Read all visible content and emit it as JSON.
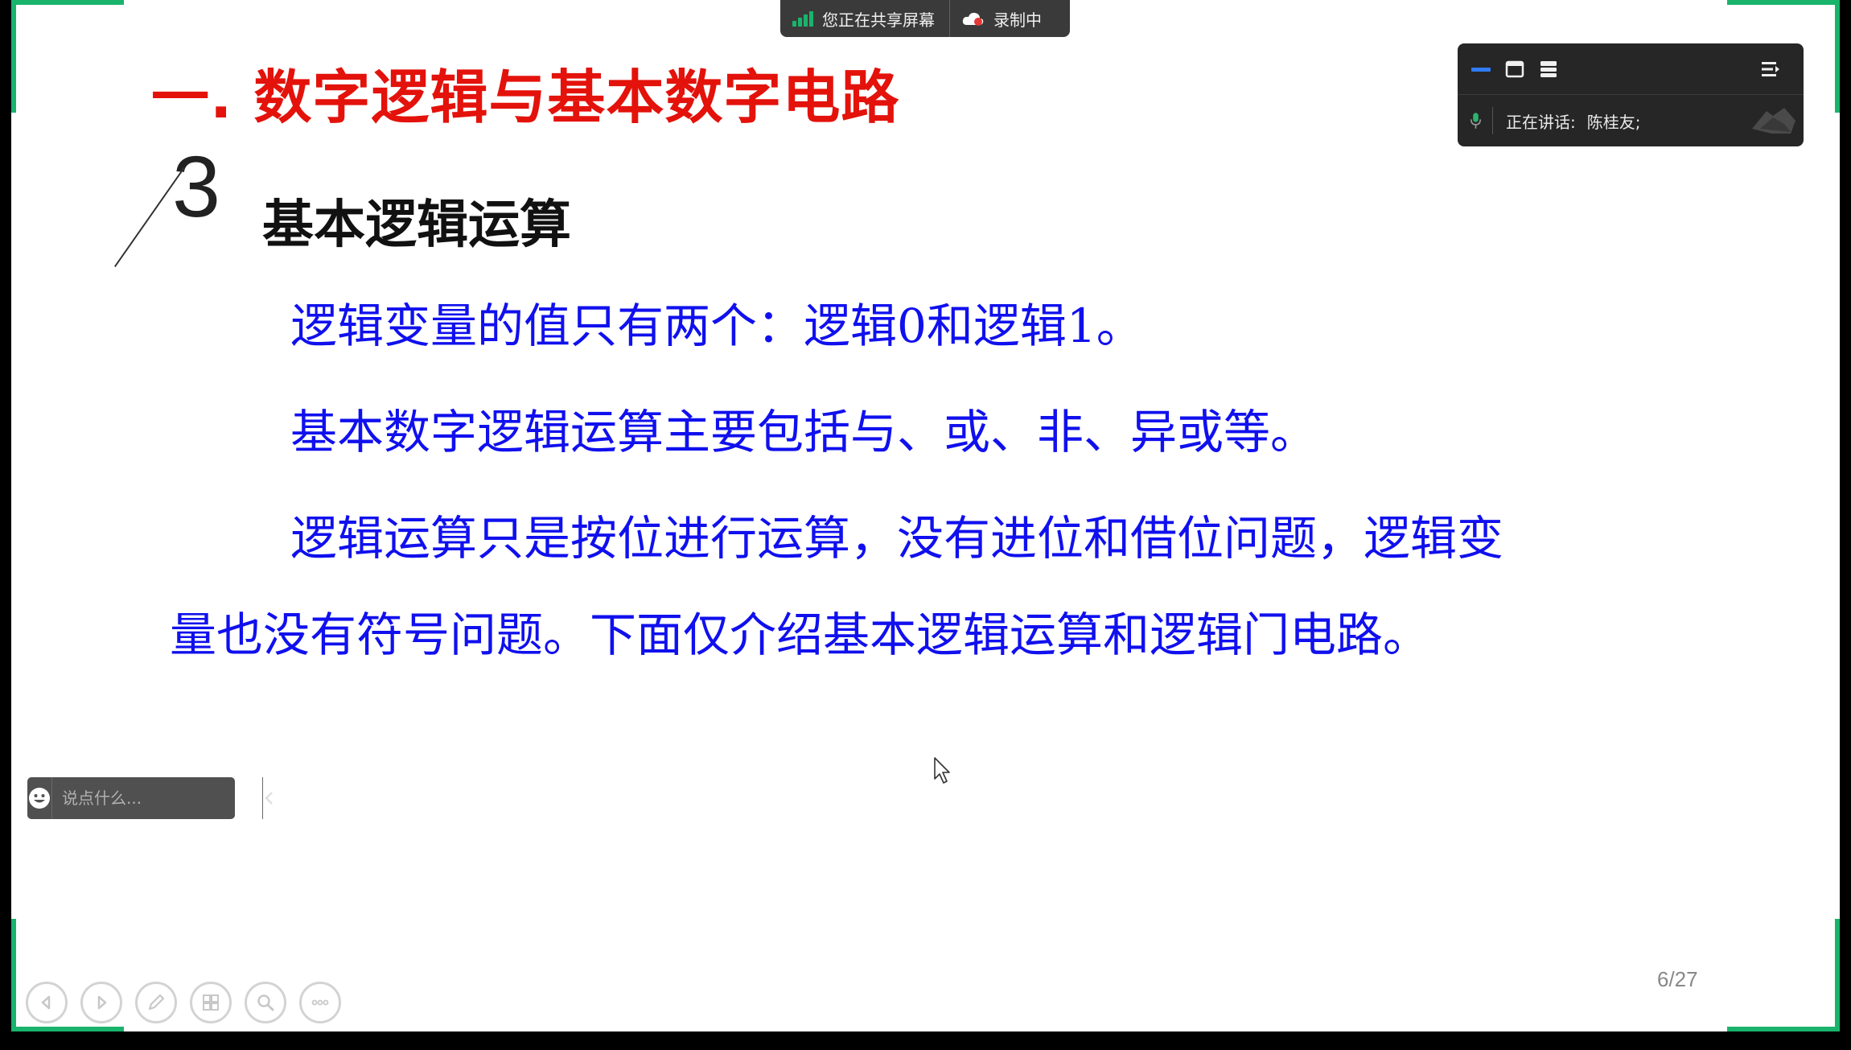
{
  "share_bar": {
    "sharing_label": "您正在共享屏幕",
    "recording_label": "录制中"
  },
  "speaker_panel": {
    "speaking_label": "正在讲话:",
    "speaker_name": "陈桂友;"
  },
  "slide": {
    "title": "一. 数字逻辑与基本数字电路",
    "section_number": "3",
    "section_heading": "基本逻辑运算",
    "paragraphs": [
      "逻辑变量的值只有两个：逻辑0和逻辑1。",
      "基本数字逻辑运算主要包括与、或、非、异或等。",
      "逻辑运算只是按位进行运算，没有进位和借位问题，逻辑变",
      "量也没有符号问题。下面仅介绍基本逻辑运算和逻辑门电路。"
    ],
    "page_number": "6/27"
  },
  "chat": {
    "placeholder": "说点什么..."
  },
  "colors": {
    "title_red": "#e3120b",
    "body_blue": "#1010ee",
    "share_green": "#19b36b",
    "panel_dark": "#262626"
  },
  "icons": {
    "toolbar": [
      "prev-slide-icon",
      "next-slide-icon",
      "pen-icon",
      "slides-grid-icon",
      "zoom-icon",
      "more-icon"
    ]
  }
}
